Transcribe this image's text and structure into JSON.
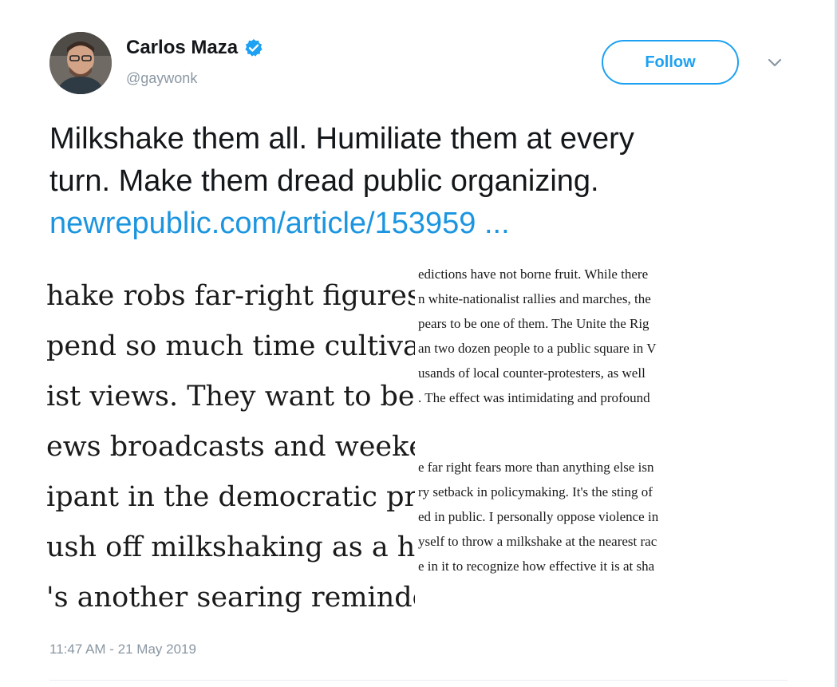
{
  "author": {
    "display_name": "Carlos Maza",
    "handle": "@gaywonk",
    "verified": true,
    "avatar_icon": "profile-photo"
  },
  "follow_label": "Follow",
  "tweet": {
    "lines": [
      "Milkshake them all. Humiliate them at every",
      "turn. Make them dread public organizing."
    ],
    "link": "newrepublic.com/article/153959 ..."
  },
  "article": {
    "left_lines": [
      "hake robs far-right figures",
      "pend so much time cultiva",
      "ist views. They want to be",
      "ews broadcasts and weeke",
      "ipant in the democratic pr",
      "ush off milkshaking as a h",
      "'s another searing reminde"
    ],
    "right_lines": [
      "edictions have not borne fruit. While there",
      "n white-nationalist rallies and marches, the",
      "pears to be one of them. The Unite the Rig",
      "an two dozen people to a public square in V",
      "usands of local counter-protesters, as well",
      ". The effect was intimidating and profound"
    ],
    "right_lines_2": [
      "e far right fears more than anything else isn",
      "ry setback in policymaking. It's the sting of",
      "ed in public. I personally oppose violence in",
      "yself to throw a milkshake at the nearest rac",
      "e in it to recognize how effective it is at sha"
    ]
  },
  "timestamp": "11:47 AM - 21 May 2019",
  "colors": {
    "accent": "#1da1f2",
    "link": "#1b95e0",
    "muted": "#8a97a3"
  }
}
